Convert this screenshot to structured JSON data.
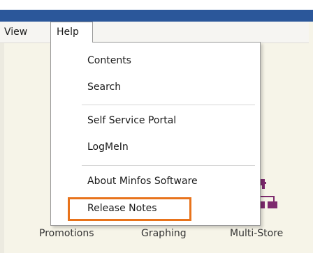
{
  "menubar": {
    "view_label": "View",
    "help_label": "Help"
  },
  "help_menu": {
    "items": [
      {
        "label": "Contents"
      },
      {
        "label": "Search"
      },
      {
        "label": "Self Service Portal"
      },
      {
        "label": "LogMeIn"
      },
      {
        "label": "About Minfos Software"
      },
      {
        "label": "Release Notes"
      }
    ]
  },
  "toolbar": {
    "promotions_label": "Promotions",
    "graphing_label": "Graphing",
    "multistore_label": "Multi-Store",
    "multistore_icon": "store-network-icon"
  },
  "colors": {
    "accent_blue": "#2b579a",
    "highlight_orange": "#e8731b",
    "icon_purple": "#7e2a6e"
  }
}
